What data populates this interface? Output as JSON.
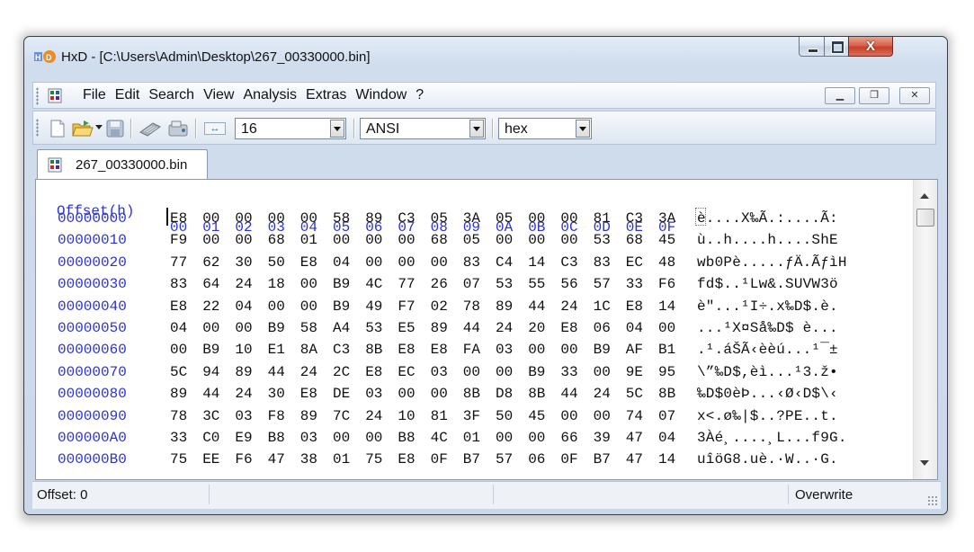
{
  "window": {
    "title": "HxD - [C:\\Users\\Admin\\Desktop\\267_00330000.bin]",
    "close_glyph": "X"
  },
  "menu": {
    "items": [
      "File",
      "Edit",
      "Search",
      "View",
      "Analysis",
      "Extras",
      "Window",
      "?"
    ]
  },
  "toolbar": {
    "bytes_per_row": "16",
    "charset": "ANSI",
    "offset_base": "hex"
  },
  "tab": {
    "label": "267_00330000.bin"
  },
  "editor": {
    "offset_header": "Offset(h)",
    "column_headers": [
      "00",
      "01",
      "02",
      "03",
      "04",
      "05",
      "06",
      "07",
      "08",
      "09",
      "0A",
      "0B",
      "0C",
      "0D",
      "0E",
      "0F"
    ],
    "rows": [
      {
        "offset": "00000000",
        "bytes": [
          "E8",
          "00",
          "00",
          "00",
          "00",
          "58",
          "89",
          "C3",
          "05",
          "3A",
          "05",
          "00",
          "00",
          "81",
          "C3",
          "3A"
        ],
        "ascii": "è....X‰Ã.:....Ã:"
      },
      {
        "offset": "00000010",
        "bytes": [
          "F9",
          "00",
          "00",
          "68",
          "01",
          "00",
          "00",
          "00",
          "68",
          "05",
          "00",
          "00",
          "00",
          "53",
          "68",
          "45"
        ],
        "ascii": "ù..h....h....ShE"
      },
      {
        "offset": "00000020",
        "bytes": [
          "77",
          "62",
          "30",
          "50",
          "E8",
          "04",
          "00",
          "00",
          "00",
          "83",
          "C4",
          "14",
          "C3",
          "83",
          "EC",
          "48"
        ],
        "ascii": "wb0Pè.....ƒÄ.ÃƒìH"
      },
      {
        "offset": "00000030",
        "bytes": [
          "83",
          "64",
          "24",
          "18",
          "00",
          "B9",
          "4C",
          "77",
          "26",
          "07",
          "53",
          "55",
          "56",
          "57",
          "33",
          "F6"
        ],
        "ascii": "fd$..¹Lw&.SUVW3ö"
      },
      {
        "offset": "00000040",
        "bytes": [
          "E8",
          "22",
          "04",
          "00",
          "00",
          "B9",
          "49",
          "F7",
          "02",
          "78",
          "89",
          "44",
          "24",
          "1C",
          "E8",
          "14"
        ],
        "ascii": "è\"...¹I÷.x‰D$.è."
      },
      {
        "offset": "00000050",
        "bytes": [
          "04",
          "00",
          "00",
          "B9",
          "58",
          "A4",
          "53",
          "E5",
          "89",
          "44",
          "24",
          "20",
          "E8",
          "06",
          "04",
          "00"
        ],
        "ascii": "...¹X¤Så‰D$ è..."
      },
      {
        "offset": "00000060",
        "bytes": [
          "00",
          "B9",
          "10",
          "E1",
          "8A",
          "C3",
          "8B",
          "E8",
          "E8",
          "FA",
          "03",
          "00",
          "00",
          "B9",
          "AF",
          "B1"
        ],
        "ascii": ".¹.áŠÃ‹èèú...¹¯±"
      },
      {
        "offset": "00000070",
        "bytes": [
          "5C",
          "94",
          "89",
          "44",
          "24",
          "2C",
          "E8",
          "EC",
          "03",
          "00",
          "00",
          "B9",
          "33",
          "00",
          "9E",
          "95"
        ],
        "ascii": "\\”‰D$,èì...¹3.ž•"
      },
      {
        "offset": "00000080",
        "bytes": [
          "89",
          "44",
          "24",
          "30",
          "E8",
          "DE",
          "03",
          "00",
          "00",
          "8B",
          "D8",
          "8B",
          "44",
          "24",
          "5C",
          "8B"
        ],
        "ascii": "‰D$0èÞ...‹Ø‹D$\\‹"
      },
      {
        "offset": "00000090",
        "bytes": [
          "78",
          "3C",
          "03",
          "F8",
          "89",
          "7C",
          "24",
          "10",
          "81",
          "3F",
          "50",
          "45",
          "00",
          "00",
          "74",
          "07"
        ],
        "ascii": "x<.ø‰|$..?PE..t."
      },
      {
        "offset": "000000A0",
        "bytes": [
          "33",
          "C0",
          "E9",
          "B8",
          "03",
          "00",
          "00",
          "B8",
          "4C",
          "01",
          "00",
          "00",
          "66",
          "39",
          "47",
          "04"
        ],
        "ascii": "3Àé¸....¸L...f9G."
      },
      {
        "offset": "000000B0",
        "bytes": [
          "75",
          "EE",
          "F6",
          "47",
          "38",
          "01",
          "75",
          "E8",
          "0F",
          "B7",
          "57",
          "06",
          "0F",
          "B7",
          "47",
          "14"
        ],
        "ascii": "uîöG8.uè.·W..·G."
      }
    ]
  },
  "status": {
    "offset": "Offset: 0",
    "mode": "Overwrite"
  }
}
